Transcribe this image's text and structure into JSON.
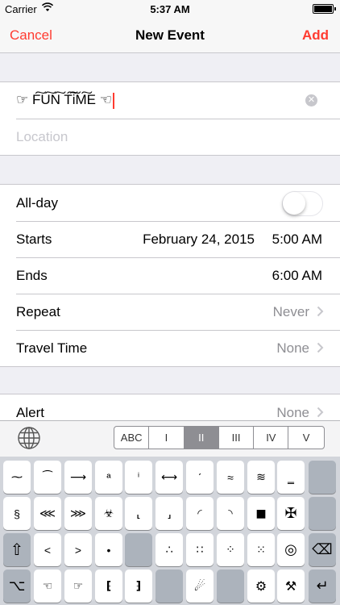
{
  "status": {
    "carrier": "Carrier",
    "time": "5:37 AM"
  },
  "nav": {
    "cancel": "Cancel",
    "title": "New Event",
    "add": "Add"
  },
  "event": {
    "title_value": "☞ F͠U͠N͠ T͠i͠M͠E ☜",
    "location_placeholder": "Location"
  },
  "rows": {
    "allday_label": "All-day",
    "starts_label": "Starts",
    "starts_date": "February 24, 2015",
    "starts_time": "5:00 AM",
    "ends_label": "Ends",
    "ends_time": "6:00 AM",
    "repeat_label": "Repeat",
    "repeat_value": "Never",
    "travel_label": "Travel Time",
    "travel_value": "None",
    "alert_label": "Alert",
    "alert_value": "None"
  },
  "keyboard": {
    "tabs": [
      "ABC",
      "I",
      "II",
      "III",
      "IV",
      "V"
    ],
    "active_tab": "II",
    "row1": [
      "⁓",
      "⁀",
      "⟶",
      "ª",
      "ⁱ",
      "⟷",
      "ˊ",
      "≈",
      "≋",
      "‗"
    ],
    "row2": [
      "§",
      "⋘",
      "⋙",
      "☣",
      "⸤",
      "⸥",
      "◜",
      "◝",
      "■",
      "✠"
    ],
    "row3": [
      "⇧",
      "<",
      ">",
      "•",
      "",
      "∴",
      "∷",
      "⁘",
      "⁙",
      "◎",
      "⌫"
    ],
    "row4": [
      "⌥",
      "☜",
      "☞",
      "⁅",
      "⁆",
      "",
      "☄",
      "",
      "⚙",
      "⚒",
      "↵"
    ]
  }
}
